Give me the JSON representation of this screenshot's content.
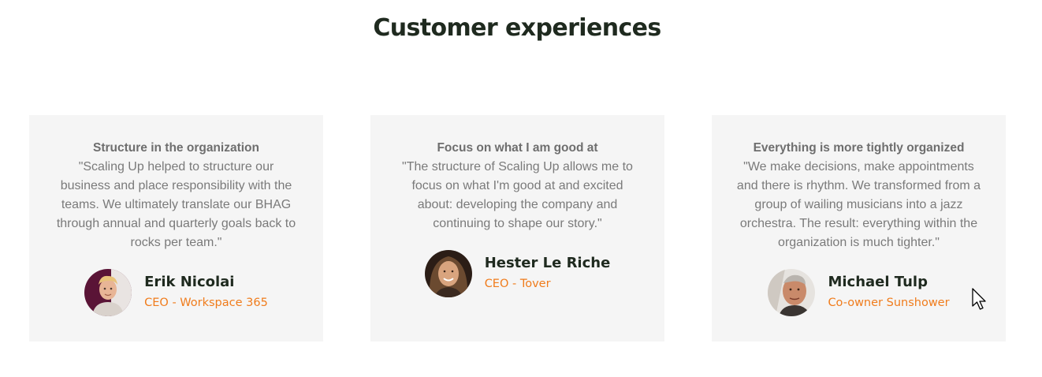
{
  "section": {
    "title": "Customer experiences"
  },
  "testimonials": [
    {
      "title": "Structure in the organization",
      "quote": "\"Scaling Up helped to structure our business and place responsibility with the teams. We ultimately translate our BHAG through annual and quarterly goals back to rocks per team.\"",
      "name": "Erik Nicolai",
      "role": "CEO - Workspace 365"
    },
    {
      "title": "Focus on what I am good at",
      "quote": "\"The structure of Scaling Up allows me to focus on what I'm good at and excited about: developing the company and continuing to shape our story.\"",
      "name": "Hester Le Riche",
      "role": "CEO - Tover"
    },
    {
      "title": "Everything is more tightly organized",
      "quote": "\"We make decisions, make appointments and there is rhythm. We transformed from a group of wailing musicians into a jazz orchestra. The result: everything within the organization is much tighter.\"",
      "name": "Michael Tulp",
      "role": "Co-owner Sunshower"
    }
  ],
  "colors": {
    "heading": "#1f2a1f",
    "body_text": "#7a7a7a",
    "accent": "#f07c1c",
    "card_bg": "#f5f5f5"
  },
  "icons": {
    "cursor": "mouse-pointer-icon"
  }
}
